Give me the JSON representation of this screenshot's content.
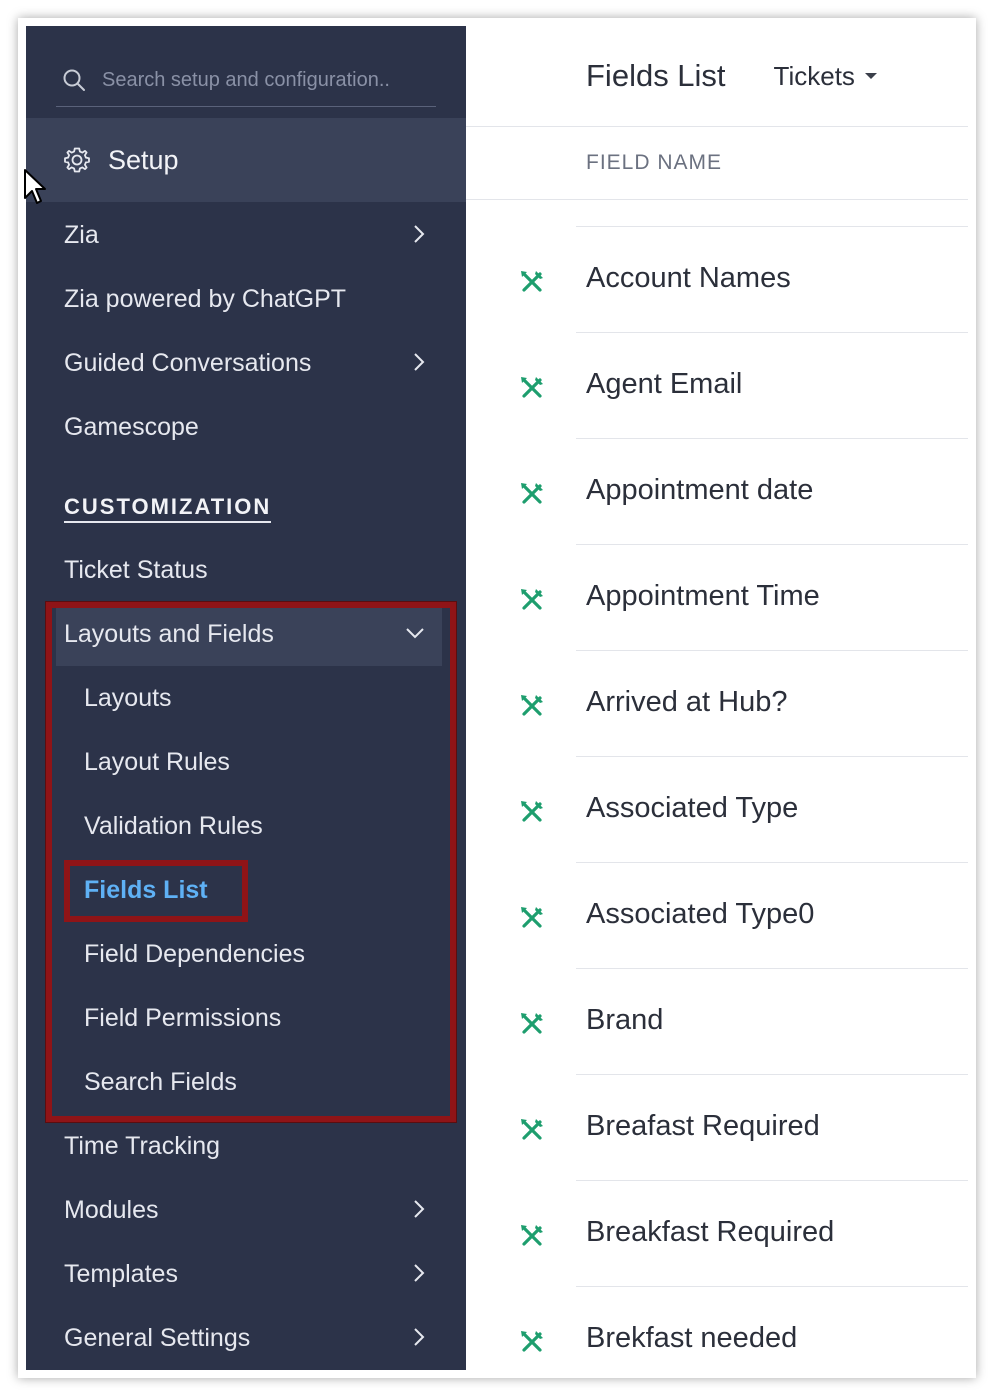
{
  "search": {
    "placeholder": "Search setup and configuration.."
  },
  "setup": {
    "label": "Setup"
  },
  "nav": {
    "zia": "Zia",
    "zia_chatgpt": "Zia powered by ChatGPT",
    "guided_conversations": "Guided Conversations",
    "gamescope": "Gamescope",
    "customization_heading": "CUSTOMIZATION",
    "ticket_status": "Ticket Status",
    "layouts_and_fields": "Layouts and Fields",
    "layouts": "Layouts",
    "layout_rules": "Layout Rules",
    "validation_rules": "Validation Rules",
    "fields_list": "Fields List",
    "field_dependencies": "Field Dependencies",
    "field_permissions": "Field Permissions",
    "search_fields": "Search Fields",
    "time_tracking": "Time Tracking",
    "modules": "Modules",
    "templates": "Templates",
    "general_settings": "General Settings"
  },
  "main": {
    "title": "Fields List",
    "module_dropdown": "Tickets",
    "column_header": "FIELD NAME",
    "fields": [
      "Account Names",
      "Agent Email",
      "Appointment date",
      "Appointment Time",
      "Arrived at Hub?",
      "Associated Type",
      "Associated Type0",
      "Brand",
      "Breafast Required",
      "Breakfast Required",
      "Brekfast needed"
    ]
  },
  "colors": {
    "sidebar_bg": "#2c3349",
    "sidebar_active_bg": "#3a4259",
    "highlight_border": "#8f1417",
    "active_link": "#5fb1f5",
    "field_icon": "#1e9e6e"
  },
  "icons": {
    "search": "search-icon",
    "setup": "gear-icon",
    "submenu": "chevron-right-icon",
    "expanded": "chevron-down-icon",
    "dropdown": "caret-down-icon",
    "custom_field": "tools-icon"
  }
}
